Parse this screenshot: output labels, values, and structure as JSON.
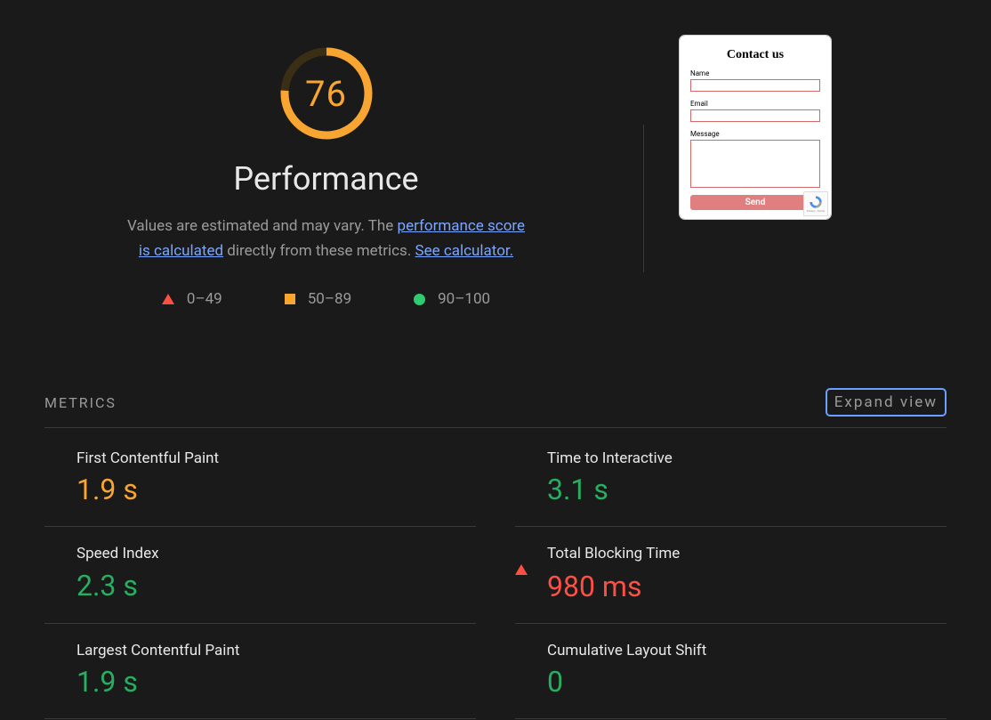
{
  "gauge": {
    "score": 76,
    "scoreText": "76",
    "max": 100
  },
  "header": {
    "title": "Performance",
    "descPrefix": "Values are estimated and may vary. The ",
    "link1": "performance score is calculated",
    "descMid": " directly from these metrics. ",
    "link2": "See calculator."
  },
  "legend": {
    "red": "0–49",
    "orange": "50–89",
    "green": "90–100"
  },
  "preview": {
    "title": "Contact us",
    "fields": {
      "name": "Name",
      "email": "Email",
      "message": "Message"
    },
    "send": "Send"
  },
  "metricsHeader": {
    "title": "METRICS",
    "expand": "Expand view"
  },
  "metrics": [
    {
      "name": "First Contentful Paint",
      "value": "1.9 s",
      "status": "orange"
    },
    {
      "name": "Time to Interactive",
      "value": "3.1 s",
      "status": "green"
    },
    {
      "name": "Speed Index",
      "value": "2.3 s",
      "status": "green"
    },
    {
      "name": "Total Blocking Time",
      "value": "980 ms",
      "status": "red"
    },
    {
      "name": "Largest Contentful Paint",
      "value": "1.9 s",
      "status": "green"
    },
    {
      "name": "Cumulative Layout Shift",
      "value": "0",
      "status": "green"
    }
  ]
}
